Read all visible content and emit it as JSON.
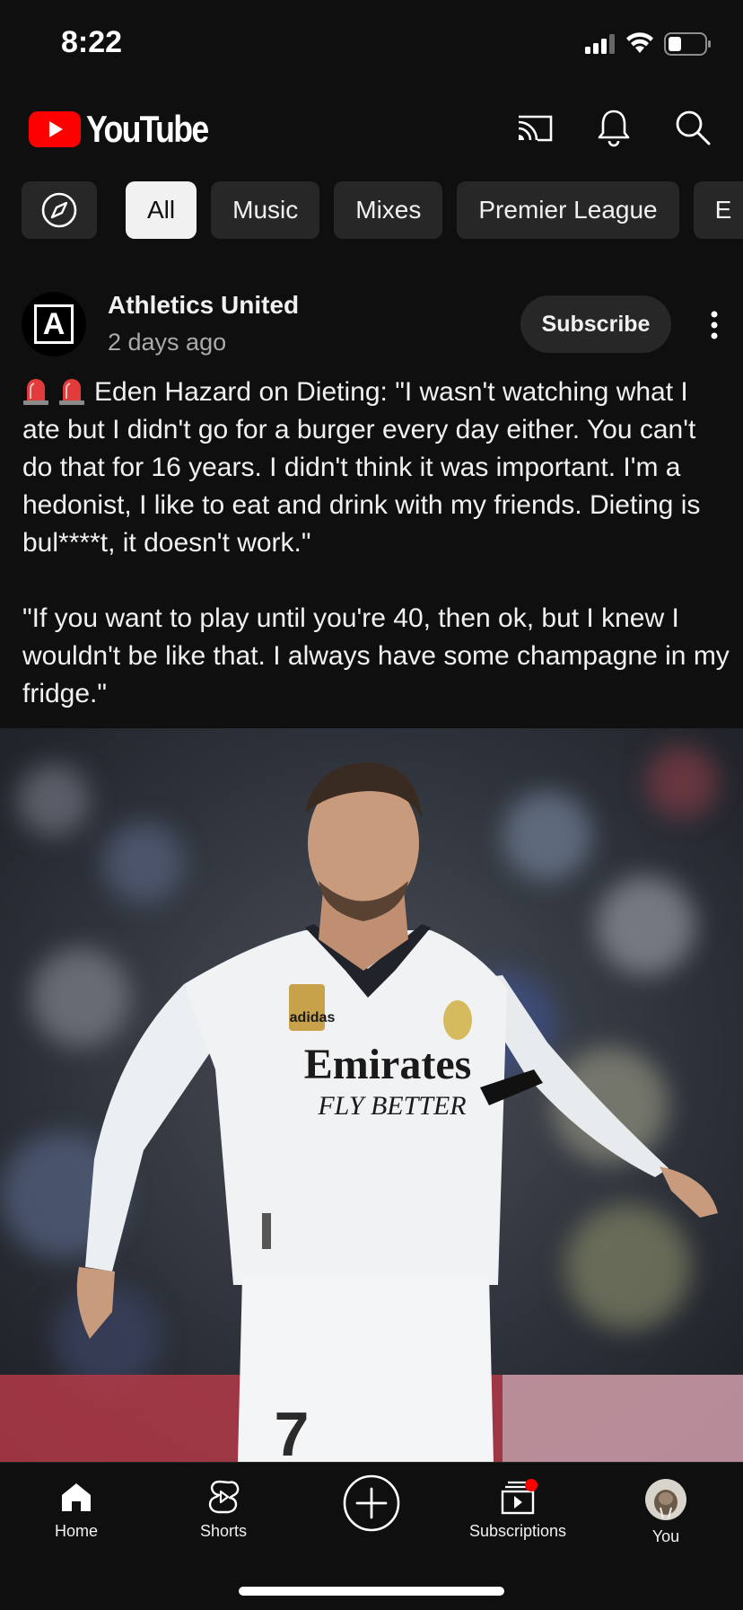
{
  "status_bar": {
    "time": "8:22"
  },
  "header": {
    "app_name": "YouTube",
    "brand_color": "#ff0000"
  },
  "chips": [
    {
      "label": "All",
      "active": true
    },
    {
      "label": "Music",
      "active": false
    },
    {
      "label": "Mixes",
      "active": false
    },
    {
      "label": "Premier League",
      "active": false
    },
    {
      "label": "E",
      "active": false
    }
  ],
  "post": {
    "channel_name": "Athletics United",
    "avatar_letter": "A",
    "posted_ago": "2 days ago",
    "subscribe_label": "Subscribe",
    "paragraph_1": "Eden Hazard on Dieting: \"I wasn't watching what I ate but I didn't go for a burger every day either. You can't do that for 16 years. I didn't think it was important. I'm a hedonist, I like to eat and drink with my friends. Dieting is bul****t, it doesn't work.\"",
    "paragraph_2": "\"If you want to play until you're 40, then ok, but I knew I wouldn't be like that. I always have some champagne in my fridge.\"",
    "image_jersey_text_1": "Emirates",
    "image_jersey_text_2": "FLY BETTER",
    "image_brand_text": "adidas",
    "image_number": "7"
  },
  "bottom_nav": {
    "home": "Home",
    "shorts": "Shorts",
    "subscriptions": "Subscriptions",
    "you": "You"
  }
}
